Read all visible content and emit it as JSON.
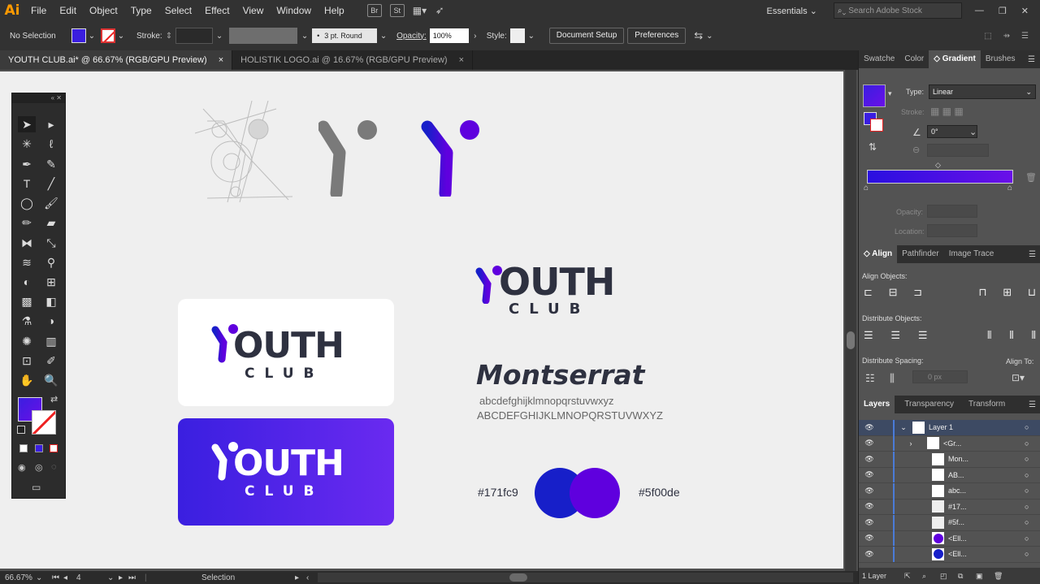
{
  "app": {
    "logo": "Ai",
    "accent": "#ff9a00"
  },
  "menu": [
    "File",
    "Edit",
    "Object",
    "Type",
    "Select",
    "Effect",
    "View",
    "Window",
    "Help"
  ],
  "menubar_right": {
    "br": "Br",
    "st": "St",
    "workspace": "Essentials",
    "search_placeholder": "Search Adobe Stock"
  },
  "control": {
    "selection": "No Selection",
    "stroke_label": "Stroke:",
    "brush": "3 pt. Round",
    "opacity_label": "Opacity:",
    "opacity_value": "100%",
    "style_label": "Style:",
    "doc_setup": "Document Setup",
    "preferences": "Preferences"
  },
  "tabs": [
    {
      "label": "YOUTH CLUB.ai* @ 66.67% (RGB/GPU Preview)",
      "close": "×"
    },
    {
      "label": "HOLISTIK LOGO.ai @ 16.67% (RGB/GPU Preview)",
      "close": "×"
    }
  ],
  "artboard": {
    "logo_youth": "OUTH",
    "logo_y": "Y",
    "logo_club": "CLUB",
    "font_name": "Montserrat",
    "lowercase": "abcdefghijklmnopqrstuvwxyz",
    "uppercase": "ABCDEFGHIJKLMNOPQRSTUVWXYZ",
    "color1": "#171fc9",
    "color2": "#5f00de"
  },
  "colors": {
    "blue": "#171fc9",
    "purple": "#5f00de",
    "dark": "#2e3140",
    "grey": "#7a7a7a"
  },
  "status": {
    "zoom": "66.67%",
    "page": "4",
    "tool": "Selection"
  },
  "gradient_panel": {
    "tabs": [
      "Swatche",
      "Color",
      "Gradient",
      "Brushes"
    ],
    "type_label": "Type:",
    "type_value": "Linear",
    "stroke_label": "Stroke:",
    "angle_value": "0°",
    "opacity_label": "Opacity:",
    "location_label": "Location:"
  },
  "align_panel": {
    "tabs": [
      "Align",
      "Pathfinder",
      "Image Trace"
    ],
    "align_objects": "Align Objects:",
    "distribute_objects": "Distribute Objects:",
    "distribute_spacing": "Distribute Spacing:",
    "align_to": "Align To:",
    "spacing_value": "0 px"
  },
  "layers_panel": {
    "tabs": [
      "Layers",
      "Transparency",
      "Transform"
    ],
    "layers": [
      {
        "name": "Layer 1",
        "thumb": "layer"
      },
      {
        "name": "<Gr...",
        "thumb": "group"
      },
      {
        "name": "Mon...",
        "thumb": "white"
      },
      {
        "name": "AB...",
        "thumb": "white"
      },
      {
        "name": "abc...",
        "thumb": "white"
      },
      {
        "name": "#17...",
        "thumb": "text"
      },
      {
        "name": "#5f...",
        "thumb": "text"
      },
      {
        "name": "<Ell...",
        "thumb": "purple"
      },
      {
        "name": "<Ell...",
        "thumb": "blue"
      }
    ],
    "footer": "1 Layer"
  }
}
